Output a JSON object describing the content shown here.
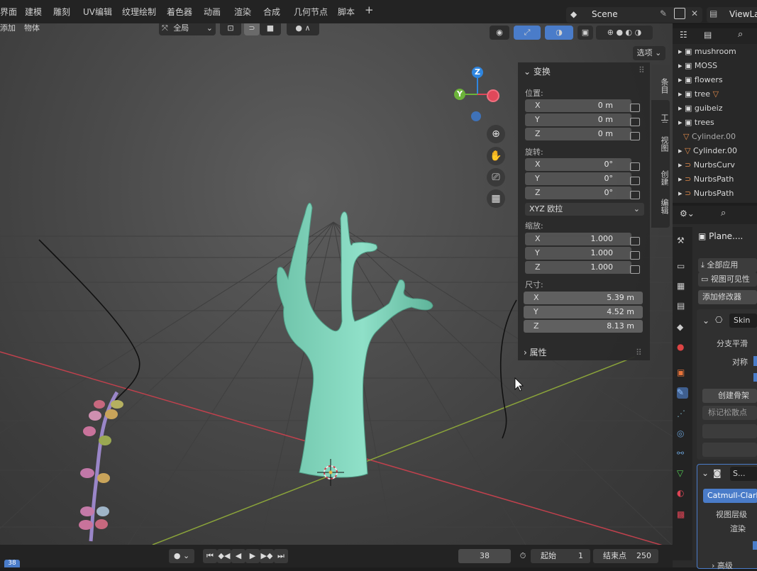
{
  "topbar": {
    "tabs": [
      "界面",
      "建模",
      "雕刻",
      "UV编辑",
      "纹理绘制",
      "着色器",
      "动画",
      "渲染",
      "合成",
      "几何节点",
      "脚本"
    ],
    "add_tab": "+",
    "scene_name": "Scene",
    "view_layer": "ViewLa"
  },
  "viewport_header": {
    "menus": [
      "添加",
      "物体"
    ],
    "transform_orientation": "全局",
    "options_label": "选项"
  },
  "npanel": {
    "transform_title": "变换",
    "location_label": "位置:",
    "location": [
      {
        "axis": "X",
        "value": "0 m"
      },
      {
        "axis": "Y",
        "value": "0 m"
      },
      {
        "axis": "Z",
        "value": "0 m"
      }
    ],
    "rotation_label": "旋转:",
    "rotation": [
      {
        "axis": "X",
        "value": "0°"
      },
      {
        "axis": "Y",
        "value": "0°"
      },
      {
        "axis": "Z",
        "value": "0°"
      }
    ],
    "rotation_mode": "XYZ 欧拉",
    "scale_label": "缩放:",
    "scale": [
      {
        "axis": "X",
        "value": "1.000"
      },
      {
        "axis": "Y",
        "value": "1.000"
      },
      {
        "axis": "Z",
        "value": "1.000"
      }
    ],
    "dimensions_label": "尺寸:",
    "dimensions": [
      {
        "axis": "X",
        "value": "5.39 m"
      },
      {
        "axis": "Y",
        "value": "4.52 m"
      },
      {
        "axis": "Z",
        "value": "8.13 m"
      }
    ],
    "properties_title": "属性",
    "side_tabs": [
      "条目",
      "工具",
      "视图",
      "创建",
      "编辑"
    ]
  },
  "gizmo": {
    "z": "Z",
    "y": "Y"
  },
  "outliner": {
    "items": [
      {
        "name": "mushroom",
        "kind": "collection"
      },
      {
        "name": "MOSS",
        "kind": "collection"
      },
      {
        "name": "flowers",
        "kind": "collection"
      },
      {
        "name": "tree",
        "kind": "collection"
      },
      {
        "name": "guibeiz",
        "kind": "collection"
      },
      {
        "name": "trees",
        "kind": "collection"
      },
      {
        "name": "Cylinder.00",
        "kind": "mesh"
      },
      {
        "name": "Cylinder.00",
        "kind": "mesh"
      },
      {
        "name": "NurbsCurv",
        "kind": "curve"
      },
      {
        "name": "NurbsPath",
        "kind": "curve"
      },
      {
        "name": "NurbsPath",
        "kind": "curve"
      }
    ]
  },
  "properties": {
    "object_name": "Plane....",
    "apply_all": "全部应用",
    "viewport_visible": "视图可见性",
    "add_modifier": "添加修改器",
    "skin_modifier": "Skin",
    "branch_smoothing": "分支平滑",
    "symmetry": "对称",
    "create_armature": "创建骨架",
    "mark_loose": "标记松散点",
    "subsurf_short": "S...",
    "catmull_clark": "Catmull-Clark",
    "viewport_levels": "视图层级",
    "render": "渲染",
    "advanced": "高级"
  },
  "timeline": {
    "current_frame": "38",
    "start_label": "起始",
    "start_value": "1",
    "end_label": "结束点",
    "end_value": "250",
    "frame_badge": "38"
  },
  "colors": {
    "tree": "#84d6be",
    "x_axis": "#c0414d",
    "y_axis": "#8aa33a",
    "gizmo_x": "#e0485a",
    "gizmo_y": "#6cb33a",
    "gizmo_z": "#2f86e0",
    "accent_blue": "#4a7cc9"
  }
}
